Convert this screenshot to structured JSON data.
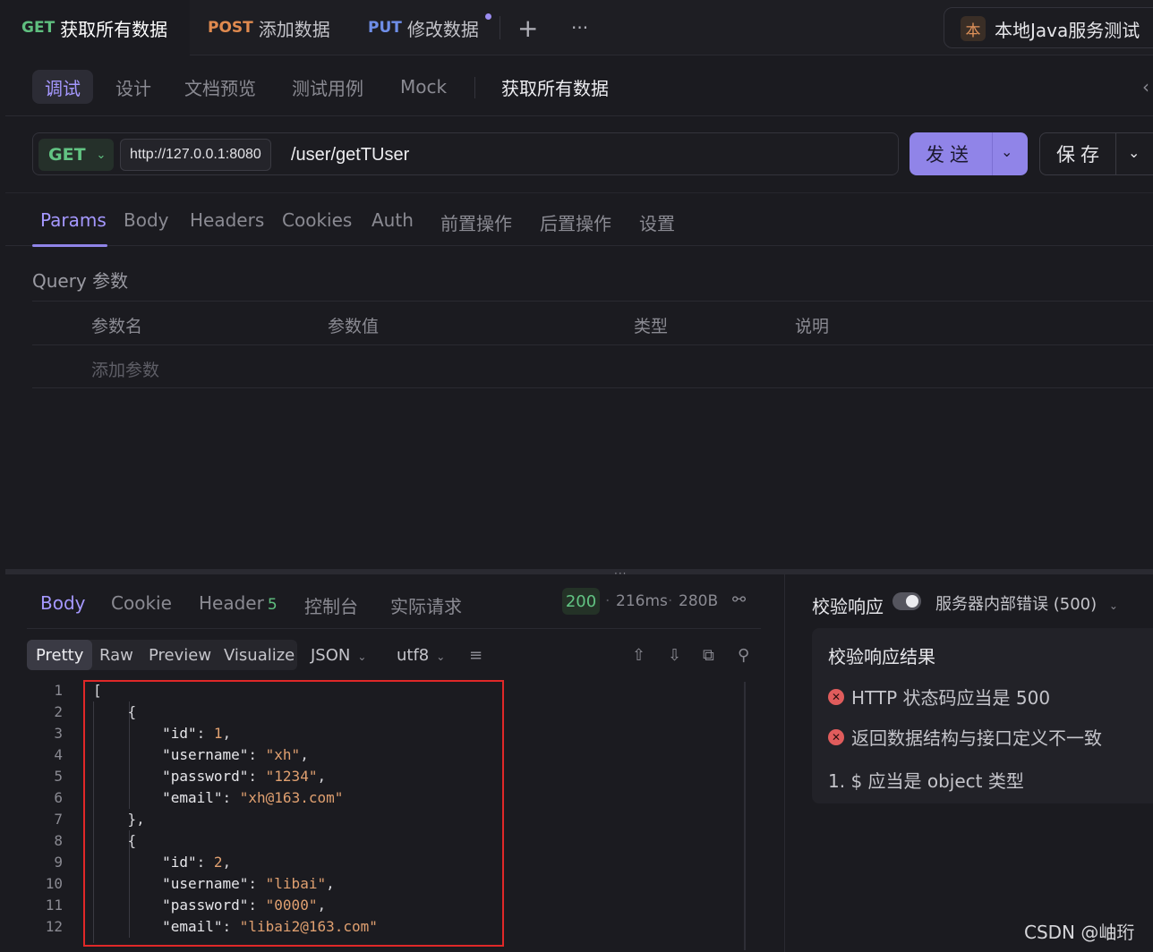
{
  "tabs": [
    {
      "method": "GET",
      "label": "获取所有数据"
    },
    {
      "method": "POST",
      "label": "添加数据"
    },
    {
      "method": "PUT",
      "label": "修改数据"
    }
  ],
  "tab_actions": {
    "add": "+",
    "more": "···"
  },
  "environment": {
    "badge": "本",
    "name": "本地Java服务测试"
  },
  "subtabs": [
    "调试",
    "设计",
    "文档预览",
    "测试用例",
    "Mock"
  ],
  "api_name": "获取所有数据",
  "request": {
    "method": "GET",
    "base_url": "http://127.0.0.1:8080",
    "path": "/user/getTUser",
    "send_label": "发送",
    "save_label": "保存"
  },
  "request_tabs": [
    "Params",
    "Body",
    "Headers",
    "Cookies",
    "Auth",
    "前置操作",
    "后置操作",
    "设置"
  ],
  "query": {
    "label": "Query 参数",
    "columns": [
      "参数名",
      "参数值",
      "类型",
      "说明"
    ],
    "add_placeholder": "添加参数"
  },
  "response": {
    "tabs": [
      "Body",
      "Cookie",
      "Header",
      "控制台",
      "实际请求"
    ],
    "header_count": "5",
    "status": "200",
    "time": "216ms",
    "size": "280B",
    "views": [
      "Pretty",
      "Raw",
      "Preview",
      "Visualize"
    ],
    "format": "JSON",
    "encoding": "utf8",
    "code_lines": [
      "[",
      "    {",
      "        \"id\": 1,",
      "        \"username\": \"xh\",",
      "        \"password\": \"1234\",",
      "        \"email\": \"xh@163.com\"",
      "    },",
      "    {",
      "        \"id\": 2,",
      "        \"username\": \"libai\",",
      "        \"password\": \"0000\",",
      "        \"email\": \"libai2@163.com\""
    ]
  },
  "validation": {
    "title": "校验响应",
    "status_select": "服务器内部错误 (500)",
    "result_title": "校验响应结果",
    "errors": [
      "HTTP 状态码应当是 500",
      "返回数据结构与接口定义不一致"
    ],
    "detail": "1. $ 应当是 object 类型"
  },
  "watermark": "CSDN @岫珩"
}
